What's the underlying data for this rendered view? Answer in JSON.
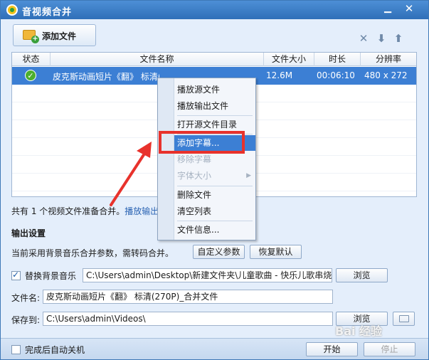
{
  "window": {
    "title": "音视频合并",
    "min_glyph": "▁",
    "close_glyph": "✕"
  },
  "toolbar": {
    "add_file_label": "添加文件",
    "icons": [
      "delete-icon",
      "move-down-icon",
      "move-up-icon"
    ],
    "delete_glyph": "✕",
    "down_glyph": "⬇",
    "up_glyph": "⬆"
  },
  "table": {
    "headers": [
      "状态",
      "文件名称",
      "文件大小",
      "时长",
      "分辨率"
    ],
    "rows": [
      {
        "status_icon": "check-icon",
        "status_glyph": "✓",
        "name": "皮克斯动画短片《翻》 标清(270P).qlv",
        "size": "12.6M",
        "duration": "00:06:10",
        "resolution": "480 x 272"
      }
    ]
  },
  "info": {
    "text": "共有 1 个视频文件准备合并。",
    "link": "播放输出"
  },
  "output": {
    "title": "输出设置",
    "params_text": "当前采用背景音乐合并参数，需转码合并。",
    "custom_params_label": "自定义参数",
    "reset_label": "恢复默认",
    "replace_bgm_label": "替换背景音乐",
    "replace_bgm_checked": true,
    "bgm_path": "C:\\Users\\admin\\Desktop\\新建文件夹\\儿童歌曲 - 快乐儿歌串烧.m",
    "browse_label": "浏览",
    "filename_label": "文件名:",
    "filename_value": "皮克斯动画短片《翻》 标清(270P)_合并文件",
    "save_label": "保存到:",
    "save_value": "C:\\Users\\admin\\Videos\\",
    "open_folder_icon": "open-folder-icon"
  },
  "status_bar": {
    "shutdown_label": "完成后自动关机",
    "shutdown_checked": false,
    "start_label": "开始",
    "stop_label": "停止"
  },
  "context_menu": {
    "items": [
      {
        "label": "播放源文件",
        "state": "normal"
      },
      {
        "label": "播放输出文件",
        "state": "normal"
      },
      {
        "label": "打开源文件目录",
        "state": "normal"
      },
      {
        "label": "添加字幕...",
        "state": "highlighted"
      },
      {
        "label": "移除字幕",
        "state": "disabled"
      },
      {
        "label": "字体大小",
        "state": "disabled",
        "submenu": true
      },
      {
        "label": "删除文件",
        "state": "normal"
      },
      {
        "label": "清空列表",
        "state": "normal"
      },
      {
        "label": "文件信息...",
        "state": "normal"
      }
    ],
    "submenu_glyph": "▶"
  },
  "annotation": {
    "highlight_color": "#e8322c"
  },
  "watermark": "Bai 经验"
}
